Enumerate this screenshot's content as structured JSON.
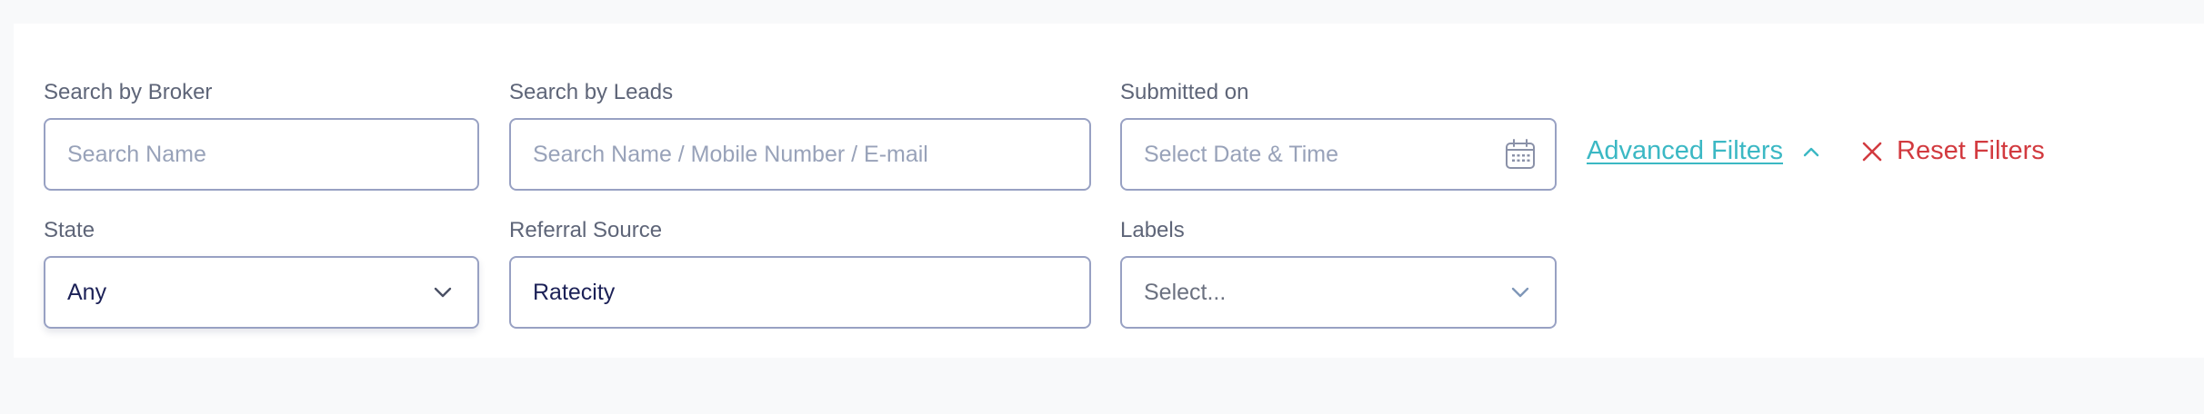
{
  "filters": {
    "broker": {
      "label": "Search by Broker",
      "placeholder": "Search Name"
    },
    "leads": {
      "label": "Search by Leads",
      "placeholder": "Search Name / Mobile Number / E-mail"
    },
    "submitted": {
      "label": "Submitted on",
      "placeholder": "Select Date & Time"
    },
    "state": {
      "label": "State",
      "value": "Any"
    },
    "referral": {
      "label": "Referral Source",
      "value": "Ratecity"
    },
    "labels": {
      "label": "Labels",
      "value": "Select..."
    }
  },
  "actions": {
    "advanced_filters": "Advanced Filters",
    "reset_filters": "Reset Filters"
  },
  "icons": {
    "calendar": "calendar-icon",
    "chevron_down": "chevron-down-icon",
    "chevron_up": "chevron-up-icon",
    "close": "close-icon"
  },
  "colors": {
    "accent": "#3bb8c4",
    "danger": "#d23a3f",
    "border": "#98a1c3",
    "text": "#1c2157",
    "label": "#5e6578"
  }
}
